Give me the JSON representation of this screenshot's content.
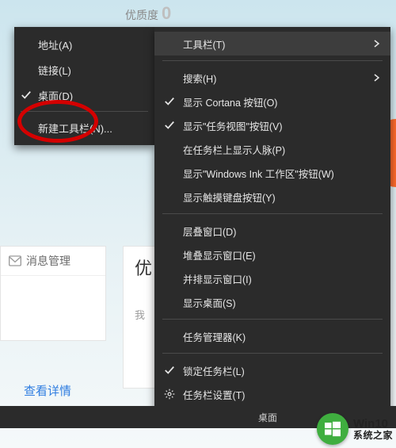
{
  "top": {
    "quality_label": "优质度",
    "quality_value": "0"
  },
  "left_menu": {
    "items": [
      {
        "label": "地址(A)",
        "checked": false
      },
      {
        "label": "链接(L)",
        "checked": false
      },
      {
        "label": "桌面(D)",
        "checked": true
      },
      {
        "label": "新建工具栏(N)...",
        "checked": false
      }
    ]
  },
  "right_menu": {
    "groups": [
      {
        "items": [
          {
            "label": "工具栏(T)",
            "submenu": true,
            "hover": true
          }
        ]
      },
      {
        "items": [
          {
            "label": "搜索(H)",
            "submenu": true
          },
          {
            "label": "显示 Cortana 按钮(O)",
            "checked": true
          },
          {
            "label": "显示\"任务视图\"按钮(V)",
            "checked": true
          },
          {
            "label": "在任务栏上显示人脉(P)"
          },
          {
            "label": "显示\"Windows Ink 工作区\"按钮(W)"
          },
          {
            "label": "显示触摸键盘按钮(Y)"
          }
        ]
      },
      {
        "items": [
          {
            "label": "层叠窗口(D)"
          },
          {
            "label": "堆叠显示窗口(E)"
          },
          {
            "label": "并排显示窗口(I)"
          },
          {
            "label": "显示桌面(S)"
          }
        ]
      },
      {
        "items": [
          {
            "label": "任务管理器(K)"
          }
        ]
      },
      {
        "items": [
          {
            "label": "锁定任务栏(L)",
            "checked": true
          },
          {
            "label": "任务栏设置(T)",
            "gear": true
          }
        ]
      }
    ]
  },
  "msg_card": {
    "title": "消息管理"
  },
  "panel": {
    "title_fragment": "优",
    "sub_fragment": "我"
  },
  "details": {
    "label": "查看详情"
  },
  "taskbar": {
    "label": "桌面"
  },
  "watermark": {
    "line1": "Win10",
    "line2": "系统之家"
  }
}
